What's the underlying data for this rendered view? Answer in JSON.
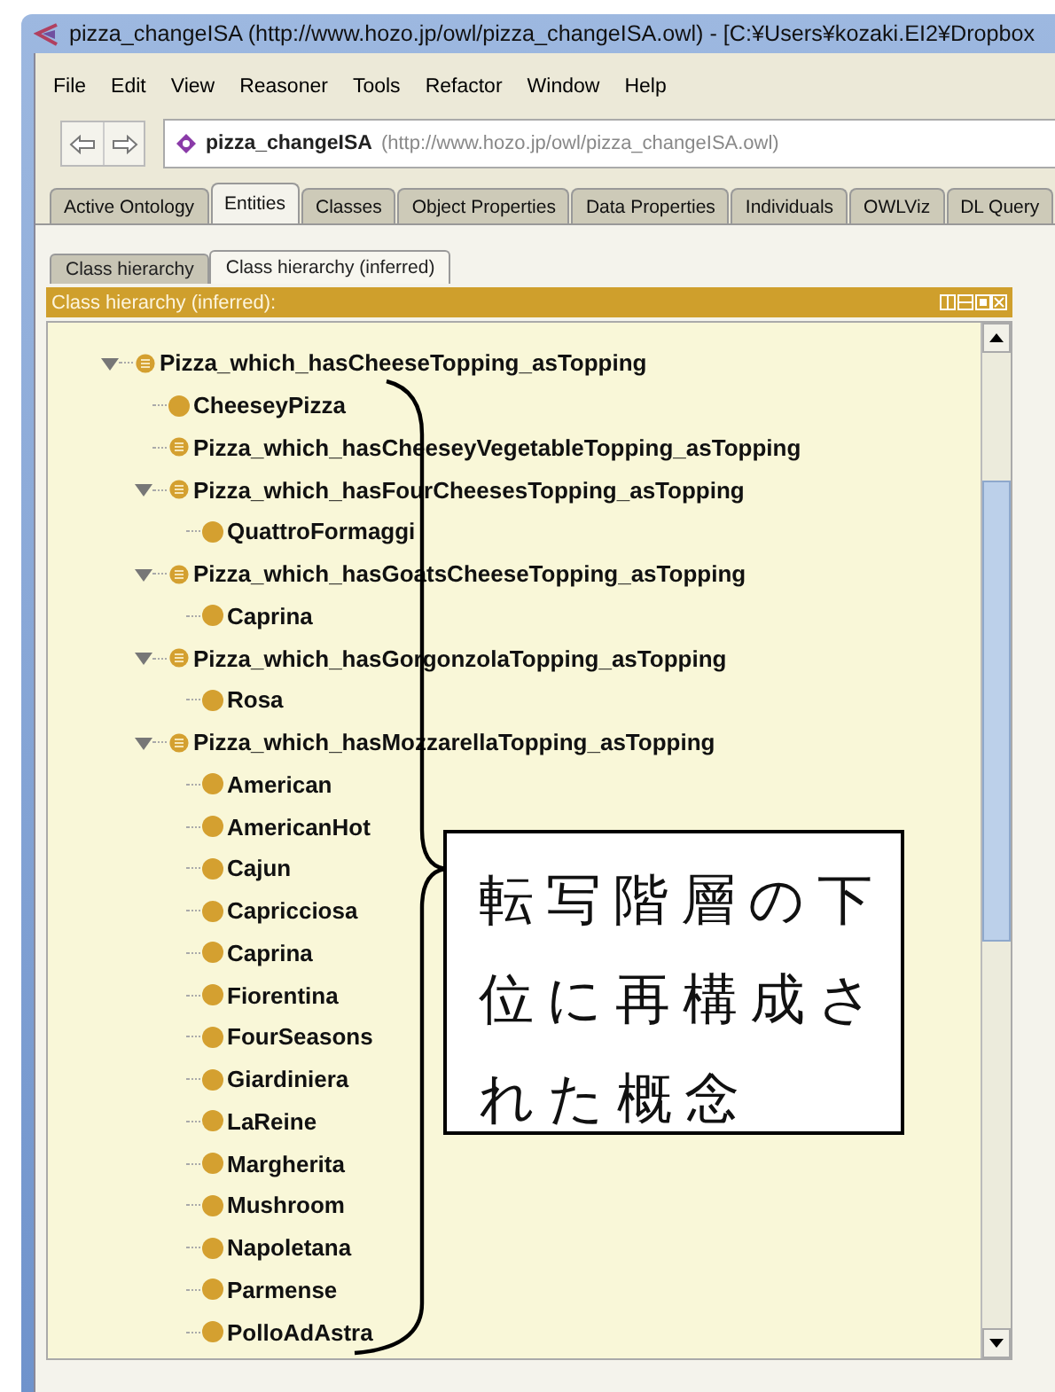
{
  "window": {
    "title": "pizza_changeISA (http://www.hozo.jp/owl/pizza_changeISA.owl) - [C:¥Users¥kozaki.EI2¥Dropbox"
  },
  "menu": [
    "File",
    "Edit",
    "View",
    "Reasoner",
    "Tools",
    "Refactor",
    "Window",
    "Help"
  ],
  "ontology": {
    "name": "pizza_changeISA",
    "uri": "(http://www.hozo.jp/owl/pizza_changeISA.owl)"
  },
  "tabs": [
    {
      "label": "Active Ontology",
      "selected": false
    },
    {
      "label": "Entities",
      "selected": true
    },
    {
      "label": "Classes",
      "selected": false
    },
    {
      "label": "Object Properties",
      "selected": false
    },
    {
      "label": "Data Properties",
      "selected": false
    },
    {
      "label": "Individuals",
      "selected": false
    },
    {
      "label": "OWLViz",
      "selected": false
    },
    {
      "label": "DL Query",
      "selected": false
    }
  ],
  "view_tabs": [
    {
      "label": "Class hierarchy",
      "selected": false
    },
    {
      "label": "Class hierarchy (inferred)",
      "selected": true
    }
  ],
  "panel": {
    "title": "Class hierarchy (inferred):"
  },
  "tree": [
    {
      "label": "Pizza_which_hasCheeseTopping_asTopping",
      "kind": "defined",
      "expanded": true,
      "children": [
        {
          "label": "CheeseyPizza",
          "kind": "primitive"
        },
        {
          "label": "Pizza_which_hasCheeseyVegetableTopping_asTopping",
          "kind": "defined"
        },
        {
          "label": "Pizza_which_hasFourCheesesTopping_asTopping",
          "kind": "defined",
          "expanded": true,
          "children": [
            {
              "label": "QuattroFormaggi",
              "kind": "primitive"
            }
          ]
        },
        {
          "label": "Pizza_which_hasGoatsCheeseTopping_asTopping",
          "kind": "defined",
          "expanded": true,
          "children": [
            {
              "label": "Caprina",
              "kind": "primitive"
            }
          ]
        },
        {
          "label": "Pizza_which_hasGorgonzolaTopping_asTopping",
          "kind": "defined",
          "expanded": true,
          "children": [
            {
              "label": "Rosa",
              "kind": "primitive"
            }
          ]
        },
        {
          "label": "Pizza_which_hasMozzarellaTopping_asTopping",
          "kind": "defined",
          "expanded": true,
          "children": [
            {
              "label": "American",
              "kind": "primitive"
            },
            {
              "label": "AmericanHot",
              "kind": "primitive"
            },
            {
              "label": "Cajun",
              "kind": "primitive"
            },
            {
              "label": "Capricciosa",
              "kind": "primitive"
            },
            {
              "label": "Caprina",
              "kind": "primitive"
            },
            {
              "label": "Fiorentina",
              "kind": "primitive"
            },
            {
              "label": "FourSeasons",
              "kind": "primitive"
            },
            {
              "label": "Giardiniera",
              "kind": "primitive"
            },
            {
              "label": "LaReine",
              "kind": "primitive"
            },
            {
              "label": "Margherita",
              "kind": "primitive"
            },
            {
              "label": "Mushroom",
              "kind": "primitive"
            },
            {
              "label": "Napoletana",
              "kind": "primitive"
            },
            {
              "label": "Parmense",
              "kind": "primitive"
            },
            {
              "label": "PolloAdAstra",
              "kind": "primitive"
            }
          ]
        }
      ]
    }
  ],
  "annotation": {
    "text": "転写階層の下位に再構成された概念"
  }
}
